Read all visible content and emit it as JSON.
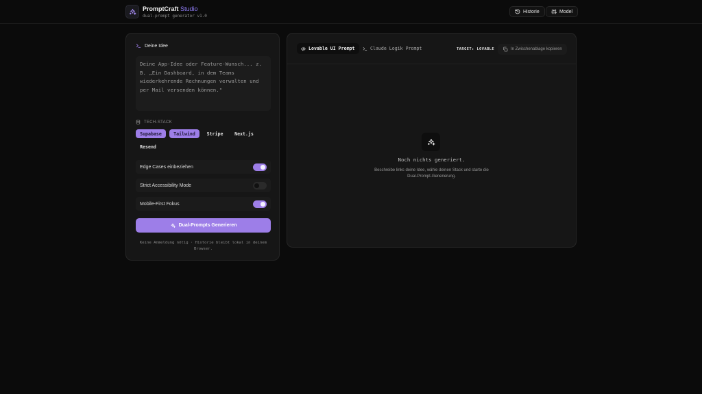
{
  "header": {
    "brand_main": "PromptCraft",
    "brand_accent": "Studio",
    "subtitle": "dual-prompt generator v1.0",
    "history_label": "Historie",
    "model_label": "Model"
  },
  "left": {
    "idea_label": "Deine Idee",
    "idea_placeholder": "Deine App-Idee oder Feature-Wunsch... z. B. „Ein Dashboard, in dem Teams wiederkehrende Rechnungen verwalten und per Mail versenden können.\"",
    "stack_label": "TECH-STACK",
    "chips": [
      {
        "label": "Supabase",
        "active": true
      },
      {
        "label": "Tailwind",
        "active": true
      },
      {
        "label": "Stripe",
        "active": false
      },
      {
        "label": "Next.js",
        "active": false
      },
      {
        "label": "Resend",
        "active": false
      }
    ],
    "toggles": [
      {
        "label": "Edge Cases einbeziehen",
        "on": true
      },
      {
        "label": "Strict Accessibility Mode",
        "on": false
      },
      {
        "label": "Mobile-First Fokus",
        "on": true
      }
    ],
    "generate_label": "Dual-Prompts Generieren",
    "note": "Keine Anmeldung nötig · Historie bleibt lokal in deinem Browser."
  },
  "right": {
    "tab_lovable": "Lovable UI Prompt",
    "tab_claude": "Claude Logik Prompt",
    "target": "TARGET: LOVABLE",
    "copy_label": "In Zwischenablage kopieren",
    "empty_title": "Noch nichts generiert.",
    "empty_desc": "Beschreibe links deine Idee, wähle deinen Stack und starte die Dual-Prompt-Generierung."
  },
  "colors": {
    "accent": "#9d7ee8",
    "background": "#0b0b0b",
    "panel": "#161616"
  },
  "icons": [
    "sparkles-icon",
    "history-icon",
    "sliders-icon",
    "terminal-icon",
    "database-icon",
    "code-icon",
    "copy-icon"
  ]
}
